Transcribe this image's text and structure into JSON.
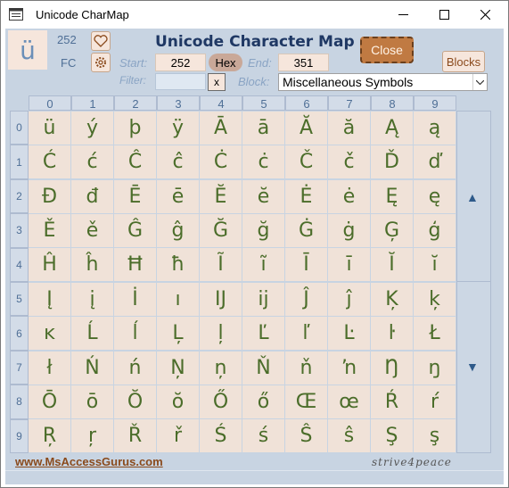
{
  "window": {
    "title": "Unicode CharMap",
    "minimize_symbol": "—",
    "maximize_symbol": "☐",
    "close_symbol": "✕"
  },
  "header": {
    "selected_char": "ü",
    "selected_decimal": "252",
    "selected_hex": "FC",
    "main_title": "Unicode Character Map",
    "close_label": "Close",
    "blocks_label": "Blocks",
    "favorite_icon": "heart-icon",
    "settings_icon": "gear-icon"
  },
  "controls": {
    "start_label": "Start:",
    "start_value": "252",
    "hex_label": "Hex",
    "end_label": "End:",
    "end_value": "351",
    "filter_label": "Filter:",
    "filter_value": "",
    "clear_filter_label": "x",
    "block_label": "Block:",
    "block_value": "Miscellaneous Symbols"
  },
  "grid": {
    "columns": [
      "0",
      "1",
      "2",
      "3",
      "4",
      "5",
      "6",
      "7",
      "8",
      "9"
    ],
    "rows": [
      "0",
      "1",
      "2",
      "3",
      "4",
      "5",
      "6",
      "7",
      "8",
      "9"
    ],
    "cells": [
      [
        "ü",
        "ý",
        "þ",
        "ÿ",
        "Ā",
        "ā",
        "Ă",
        "ă",
        "Ą",
        "ą"
      ],
      [
        "Ć",
        "ć",
        "Ĉ",
        "ĉ",
        "Ċ",
        "ċ",
        "Č",
        "č",
        "Ď",
        "ď"
      ],
      [
        "Đ",
        "đ",
        "Ē",
        "ē",
        "Ĕ",
        "ĕ",
        "Ė",
        "ė",
        "Ę",
        "ę"
      ],
      [
        "Ě",
        "ě",
        "Ĝ",
        "ĝ",
        "Ğ",
        "ğ",
        "Ġ",
        "ġ",
        "Ģ",
        "ģ"
      ],
      [
        "Ĥ",
        "ĥ",
        "Ħ",
        "ħ",
        "Ĩ",
        "ĩ",
        "Ī",
        "ī",
        "Ĭ",
        "ĭ"
      ],
      [
        "Į",
        "į",
        "İ",
        "ı",
        "Ĳ",
        "ĳ",
        "Ĵ",
        "ĵ",
        "Ķ",
        "ķ"
      ],
      [
        "ĸ",
        "Ĺ",
        "ĺ",
        "Ļ",
        "ļ",
        "Ľ",
        "ľ",
        "Ŀ",
        "ŀ",
        "Ł"
      ],
      [
        "ł",
        "Ń",
        "ń",
        "Ņ",
        "ņ",
        "Ň",
        "ň",
        "ŉ",
        "Ŋ",
        "ŋ"
      ],
      [
        "Ō",
        "ō",
        "Ŏ",
        "ŏ",
        "Ő",
        "ő",
        "Œ",
        "œ",
        "Ŕ",
        "ŕ"
      ],
      [
        "Ŗ",
        "ŗ",
        "Ř",
        "ř",
        "Ś",
        "ś",
        "Ŝ",
        "ŝ",
        "Ş",
        "ş"
      ]
    ],
    "scroll_up_symbol": "▲",
    "scroll_down_symbol": "▼"
  },
  "footer": {
    "link": "www.MsAccessGurus.com",
    "motto": "strive4peace"
  },
  "colors": {
    "accent": "#1f3864",
    "cell_bg": "#f0e2d8",
    "glyph": "#4b6d2a",
    "close_button": "#c07a42",
    "background": "#c8d4e2"
  }
}
